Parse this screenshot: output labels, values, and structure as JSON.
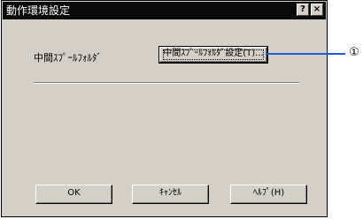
{
  "window": {
    "title": "動作環境設定",
    "help_button": "?",
    "close_button": "×"
  },
  "main": {
    "spool_label": "中間ｽﾌﾟｰﾙﾌｫﾙﾀﾞ",
    "spool_setting_button": "中間ｽﾌﾟｰﾙﾌｫﾙﾀﾞ設定(T)..."
  },
  "buttons": {
    "ok": "OK",
    "cancel": "ｷｬﾝｾﾙ",
    "help": "ﾍﾙﾌﾟ(H)"
  },
  "annotation": {
    "callout_number": "①",
    "line_color": "#1e5bd6"
  }
}
